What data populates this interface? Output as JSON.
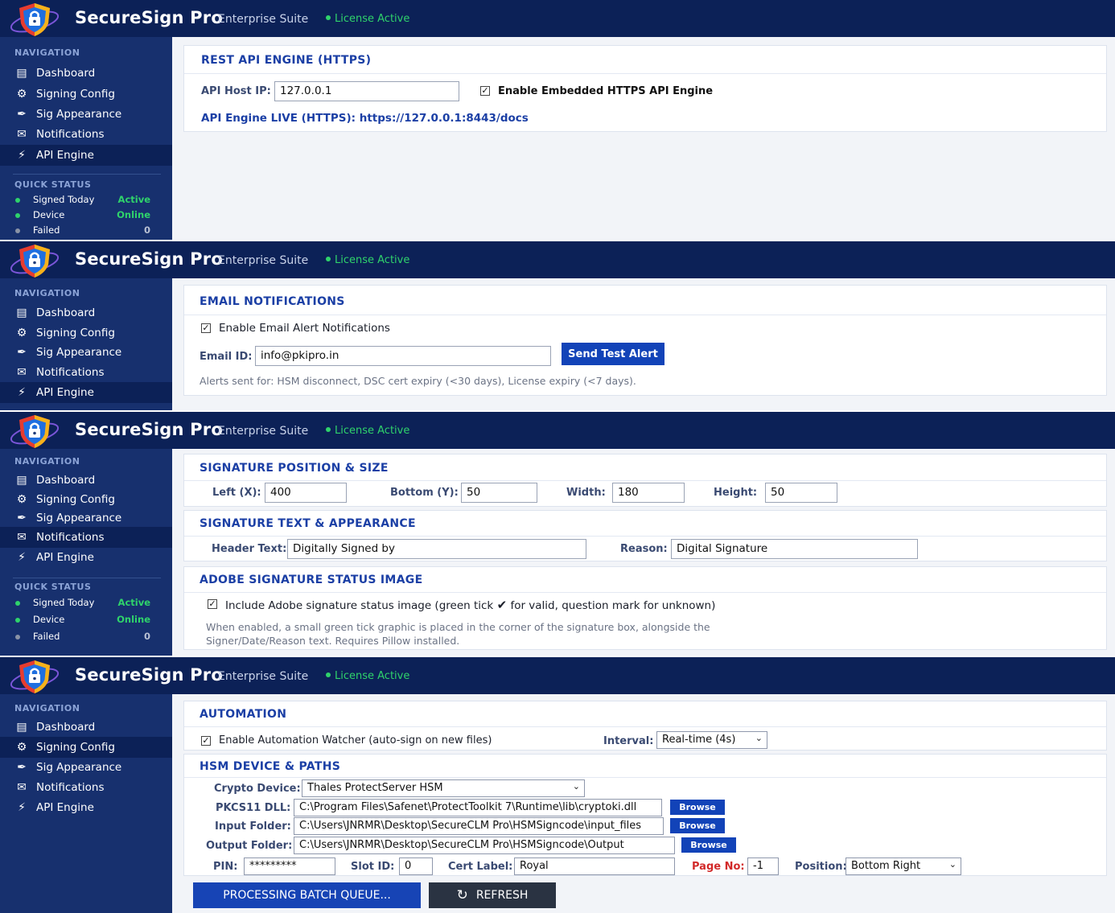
{
  "header": {
    "app_title": "SecureSign Pro",
    "suite": "Enterprise Suite",
    "license": "License Active"
  },
  "nav": {
    "heading": "NAVIGATION",
    "items": [
      {
        "label": "Dashboard",
        "icon": "dashboard-icon"
      },
      {
        "label": "Signing Config",
        "icon": "gear-icon"
      },
      {
        "label": "Sig Appearance",
        "icon": "pen-icon"
      },
      {
        "label": "Notifications",
        "icon": "envelope-icon"
      },
      {
        "label": "API Engine",
        "icon": "bolt-icon"
      }
    ]
  },
  "quick_status": {
    "heading": "QUICK STATUS",
    "rows": [
      {
        "label": "Signed Today",
        "value": "Active",
        "color": "#2fd36b"
      },
      {
        "label": "Device",
        "value": "Online",
        "color": "#2fd36b"
      },
      {
        "label": "Failed",
        "value": "0",
        "color": "#8a93a6"
      }
    ]
  },
  "api_panel": {
    "title": "REST API ENGINE (HTTPS)",
    "host_label": "API Host IP:",
    "host_value": "127.0.0.1",
    "enable_label": "Enable Embedded HTTPS API Engine",
    "live_text": "API Engine LIVE (HTTPS): https://127.0.0.1:8443/docs"
  },
  "email_panel": {
    "title": "EMAIL NOTIFICATIONS",
    "enable_label": "Enable Email Alert Notifications",
    "email_label": "Email ID:",
    "email_value": "info@pkipro.in",
    "send_button": "Send Test Alert",
    "note": "Alerts sent for: HSM disconnect, DSC cert expiry (<30 days), License expiry (<7 days)."
  },
  "appearance_panel": {
    "pos_title": "SIGNATURE POSITION & SIZE",
    "left_label": "Left (X):",
    "left_value": "400",
    "bottom_label": "Bottom (Y):",
    "bottom_value": "50",
    "width_label": "Width:",
    "width_value": "180",
    "height_label": "Height:",
    "height_value": "50",
    "text_title": "SIGNATURE TEXT & APPEARANCE",
    "header_label": "Header Text:",
    "header_value": "Digitally Signed by",
    "reason_label": "Reason:",
    "reason_value": "Digital Signature",
    "adobe_title": "ADOBE SIGNATURE STATUS IMAGE",
    "adobe_check_a": "Include Adobe signature status image (green tick",
    "adobe_check_b": "for valid, question mark for unknown)",
    "adobe_note_1": "When enabled, a small green tick graphic is placed in the corner of the signature box, alongside the",
    "adobe_note_2": "Signer/Date/Reason text. Requires Pillow installed."
  },
  "config_panel": {
    "auto_title": "AUTOMATION",
    "auto_label": "Enable Automation Watcher (auto-sign on new files)",
    "interval_label": "Interval:",
    "interval_value": "Real-time (4s)",
    "hsm_title": "HSM DEVICE & PATHS",
    "crypto_label": "Crypto Device:",
    "crypto_value": "Thales ProtectServer HSM",
    "pkcs_label": "PKCS11 DLL:",
    "pkcs_value": "C:\\Program Files\\Safenet\\ProtectToolkit 7\\Runtime\\lib\\cryptoki.dll",
    "input_label": "Input Folder:",
    "input_value": "C:\\Users\\JNRMR\\Desktop\\SecureCLM Pro\\HSMSigncode\\input_files",
    "output_label": "Output Folder:",
    "output_value": "C:\\Users\\JNRMR\\Desktop\\SecureCLM Pro\\HSMSigncode\\Output",
    "browse": "Browse",
    "pin_label": "PIN:",
    "pin_value": "*********",
    "slot_label": "Slot ID:",
    "slot_value": "0",
    "cert_label": "Cert Label:",
    "cert_value": "Royal",
    "page_label": "Page No:",
    "page_value": "-1",
    "position_label": "Position:",
    "position_value": "Bottom Right",
    "process_button": "PROCESSING BATCH QUEUE...",
    "refresh_button": "REFRESH"
  }
}
